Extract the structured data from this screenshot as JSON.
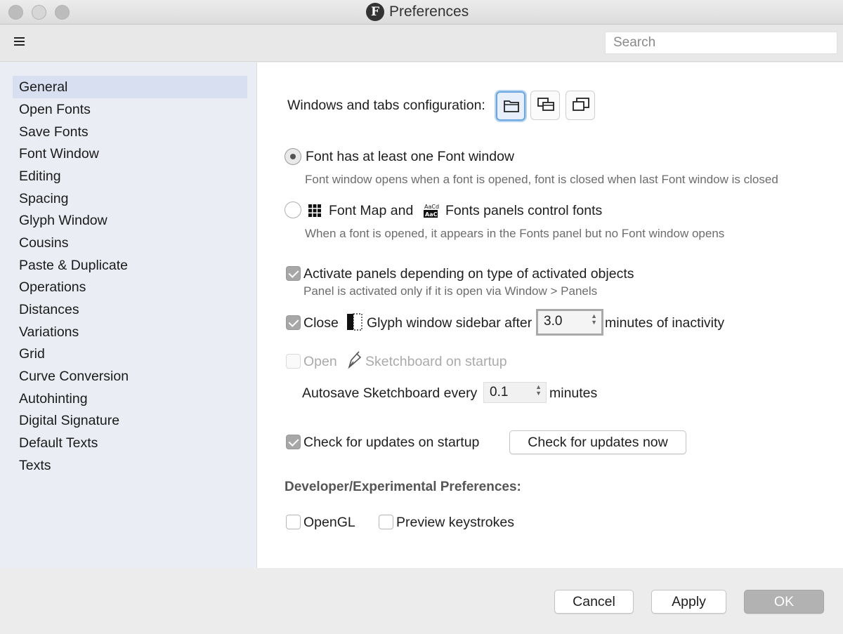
{
  "window": {
    "title": "Preferences",
    "app_logo_letter": "F"
  },
  "toolbar": {
    "search_placeholder": "Search"
  },
  "sidebar": {
    "items": [
      {
        "label": "General",
        "active": true
      },
      {
        "label": "Open Fonts"
      },
      {
        "label": "Save Fonts"
      },
      {
        "label": "Font Window"
      },
      {
        "label": "Editing"
      },
      {
        "label": "Spacing"
      },
      {
        "label": "Glyph Window"
      },
      {
        "label": "Cousins"
      },
      {
        "label": "Paste & Duplicate"
      },
      {
        "label": "Operations"
      },
      {
        "label": "Distances"
      },
      {
        "label": "Variations"
      },
      {
        "label": "Grid"
      },
      {
        "label": "Curve Conversion"
      },
      {
        "label": "Autohinting"
      },
      {
        "label": "Digital Signature"
      },
      {
        "label": "Default Texts"
      },
      {
        "label": "Texts"
      }
    ]
  },
  "general": {
    "windows_tabs_label": "Windows and tabs configuration:",
    "windows_tabs_options": [
      "folder-icon",
      "stacked-windows-icon",
      "overlapping-windows-icon"
    ],
    "windows_tabs_selected": 0,
    "radio_font_window": {
      "label": "Font has at least one Font window",
      "description": "Font window opens when a font is opened, font is closed when last Font window is closed",
      "selected": true
    },
    "radio_panels": {
      "label_part1": "Font Map and",
      "label_part2": "Fonts panels control fonts",
      "description": "When a font is opened, it appears in the Fonts panel but no Font window opens",
      "selected": false
    },
    "activate_panels": {
      "label": "Activate panels depending on type of activated objects",
      "description": "Panel is activated only if it is open via Window > Panels",
      "checked": true
    },
    "close_sidebar": {
      "label_part1": "Close",
      "label_part2": "Glyph window sidebar after",
      "value": "3.0",
      "label_part3": "minutes of inactivity",
      "checked": true
    },
    "open_sketchboard": {
      "label_part1": "Open",
      "label_part2": "Sketchboard on startup",
      "checked": false,
      "enabled": false
    },
    "autosave": {
      "label_part1": "Autosave Sketchboard every",
      "value": "0.1",
      "label_part2": "minutes"
    },
    "check_updates": {
      "label": "Check for updates on startup",
      "checked": true,
      "button_label": "Check for updates now"
    },
    "developer": {
      "heading": "Developer/Experimental Preferences:",
      "opengl_label": "OpenGL",
      "opengl_checked": false,
      "preview_label": "Preview keystrokes",
      "preview_checked": false
    }
  },
  "footer": {
    "cancel_label": "Cancel",
    "apply_label": "Apply",
    "ok_label": "OK"
  },
  "colors": {
    "sidebar_bg": "#eaedf3",
    "sidebar_selected": "#d7dff0",
    "accent_focus": "#6aa7e0",
    "ok_button": "#b2b2b2"
  }
}
